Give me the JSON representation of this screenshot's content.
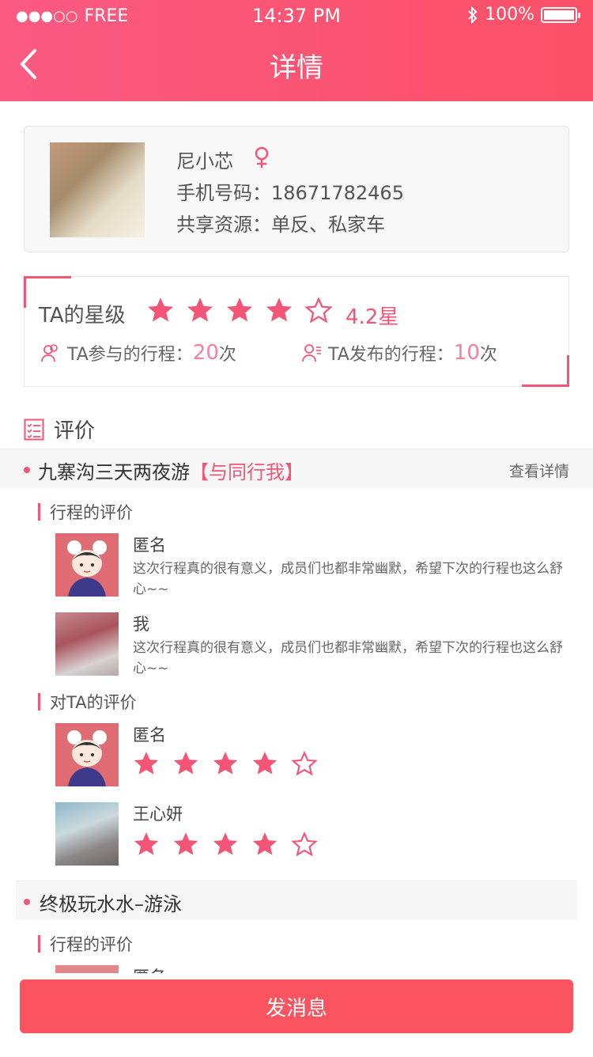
{
  "status": {
    "signal_dots": "●●●○○",
    "carrier": "FREE",
    "time": "14:37 PM",
    "bluetooth": "∦",
    "battery": "100%"
  },
  "nav": {
    "title": "详情",
    "back_icon": "chevron-left-icon"
  },
  "profile": {
    "name": "尼小芯",
    "gender_icon": "female-icon",
    "phone": "手机号码：18671782465",
    "share": "共享资源：单反、私家车"
  },
  "rating": {
    "label": "TA的星级",
    "stars": 4,
    "max_stars": 5,
    "value": "4.2星",
    "joined_label": "TA参与的行程：",
    "joined_num": "20",
    "joined_unit": "次",
    "published_label": "TA发布的行程：",
    "published_num": "10",
    "published_unit": "次"
  },
  "evaluation": {
    "title": "评价",
    "trips": [
      {
        "name": "九寨沟三天两夜游",
        "tag": "【与同行我】",
        "detail": "查看详情",
        "trip_section": "行程的评价",
        "ta_section": "对TA的评价",
        "trip_reviews": [
          {
            "name": "匿名",
            "text": "这次行程真的很有意义，成员们也都非常幽默，希望下次的行程也这么舒心~~"
          },
          {
            "name": "我",
            "text": "这次行程真的很有意义，成员们也都非常幽默，希望下次的行程也这么舒心~~"
          }
        ],
        "ta_reviews": [
          {
            "name": "匿名",
            "stars": 4
          },
          {
            "name": "王心妍",
            "stars": 4
          }
        ]
      },
      {
        "name": "终极玩水水–游泳",
        "trip_section": "行程的评价",
        "trip_reviews": [
          {
            "name": "匿名"
          }
        ]
      }
    ]
  },
  "actions": {
    "send_message": "发消息"
  },
  "colors": {
    "accent": "#f25575",
    "header_start": "#fb5a82",
    "header_end": "#fb5067",
    "button": "#f9545f"
  }
}
